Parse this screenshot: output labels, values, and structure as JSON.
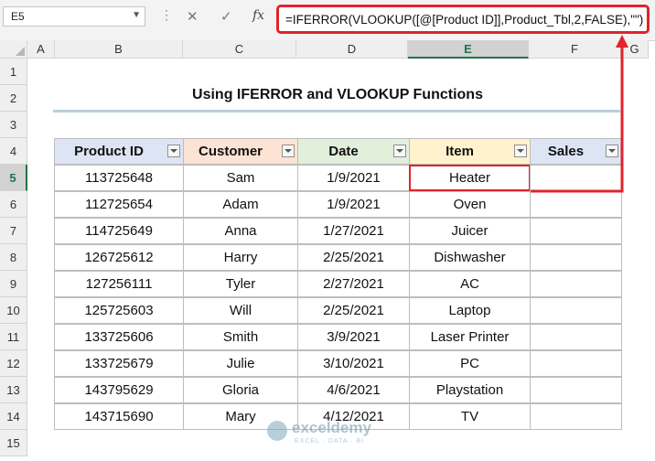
{
  "formula_bar": {
    "name_box": "E5",
    "dots": "⋮",
    "cancel_glyph": "✕",
    "enter_glyph": "✓",
    "fx_glyph": "fx",
    "formula": "=IFERROR(VLOOKUP([@[Product ID]],Product_Tbl,2,FALSE),\"\")"
  },
  "columns": [
    "A",
    "B",
    "C",
    "D",
    "E",
    "F",
    "G"
  ],
  "selected_column": "E",
  "rows": [
    "1",
    "2",
    "3",
    "4",
    "5",
    "6",
    "7",
    "8",
    "9",
    "10",
    "11",
    "12",
    "13",
    "14",
    "15"
  ],
  "selected_row": "5",
  "title": "Using IFERROR and VLOOKUP Functions",
  "table": {
    "headers": [
      "Product ID",
      "Customer",
      "Date",
      "Item",
      "Sales"
    ],
    "header_colors": [
      "#dde5f5",
      "#fce3d4",
      "#e2efda",
      "#fff2cc",
      "#dde5f5"
    ],
    "rows": [
      [
        "113725648",
        "Sam",
        "1/9/2021",
        "Heater",
        ""
      ],
      [
        "112725654",
        "Adam",
        "1/9/2021",
        "Oven",
        ""
      ],
      [
        "114725649",
        "Anna",
        "1/27/2021",
        "Juicer",
        ""
      ],
      [
        "126725612",
        "Harry",
        "2/25/2021",
        "Dishwasher",
        ""
      ],
      [
        "127256111",
        "Tyler",
        "2/27/2021",
        "AC",
        ""
      ],
      [
        "125725603",
        "Will",
        "2/25/2021",
        "Laptop",
        ""
      ],
      [
        "133725606",
        "Smith",
        "3/9/2021",
        "Laser Printer",
        ""
      ],
      [
        "133725679",
        "Julie",
        "3/10/2021",
        "PC",
        ""
      ],
      [
        "143795629",
        "Gloria",
        "4/6/2021",
        "Playstation",
        ""
      ],
      [
        "143715690",
        "Mary",
        "4/12/2021",
        "TV",
        ""
      ]
    ]
  },
  "watermark": {
    "name": "exceldemy",
    "tagline": "EXCEL · DATA · BI"
  },
  "accent_color": "#e0242b"
}
